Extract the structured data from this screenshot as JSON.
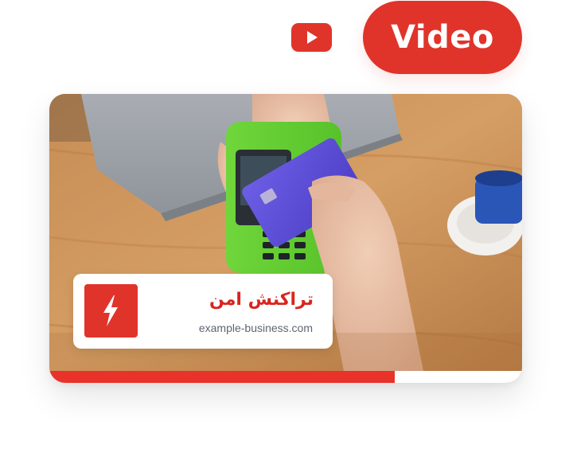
{
  "header": {
    "youtube_icon": "youtube-play-icon",
    "video_label": "Video"
  },
  "card": {
    "photo": "payment-terminal-card-tap-photo",
    "info": {
      "icon": "lightning-bolt-icon",
      "title": "تراکنش امن",
      "url": "example-business.com"
    },
    "progress": 0.73
  },
  "colors": {
    "accent_red": "#e0342b",
    "title_red": "#d8251f",
    "url_gray": "#5e6570",
    "progress_red": "#e8322a"
  }
}
